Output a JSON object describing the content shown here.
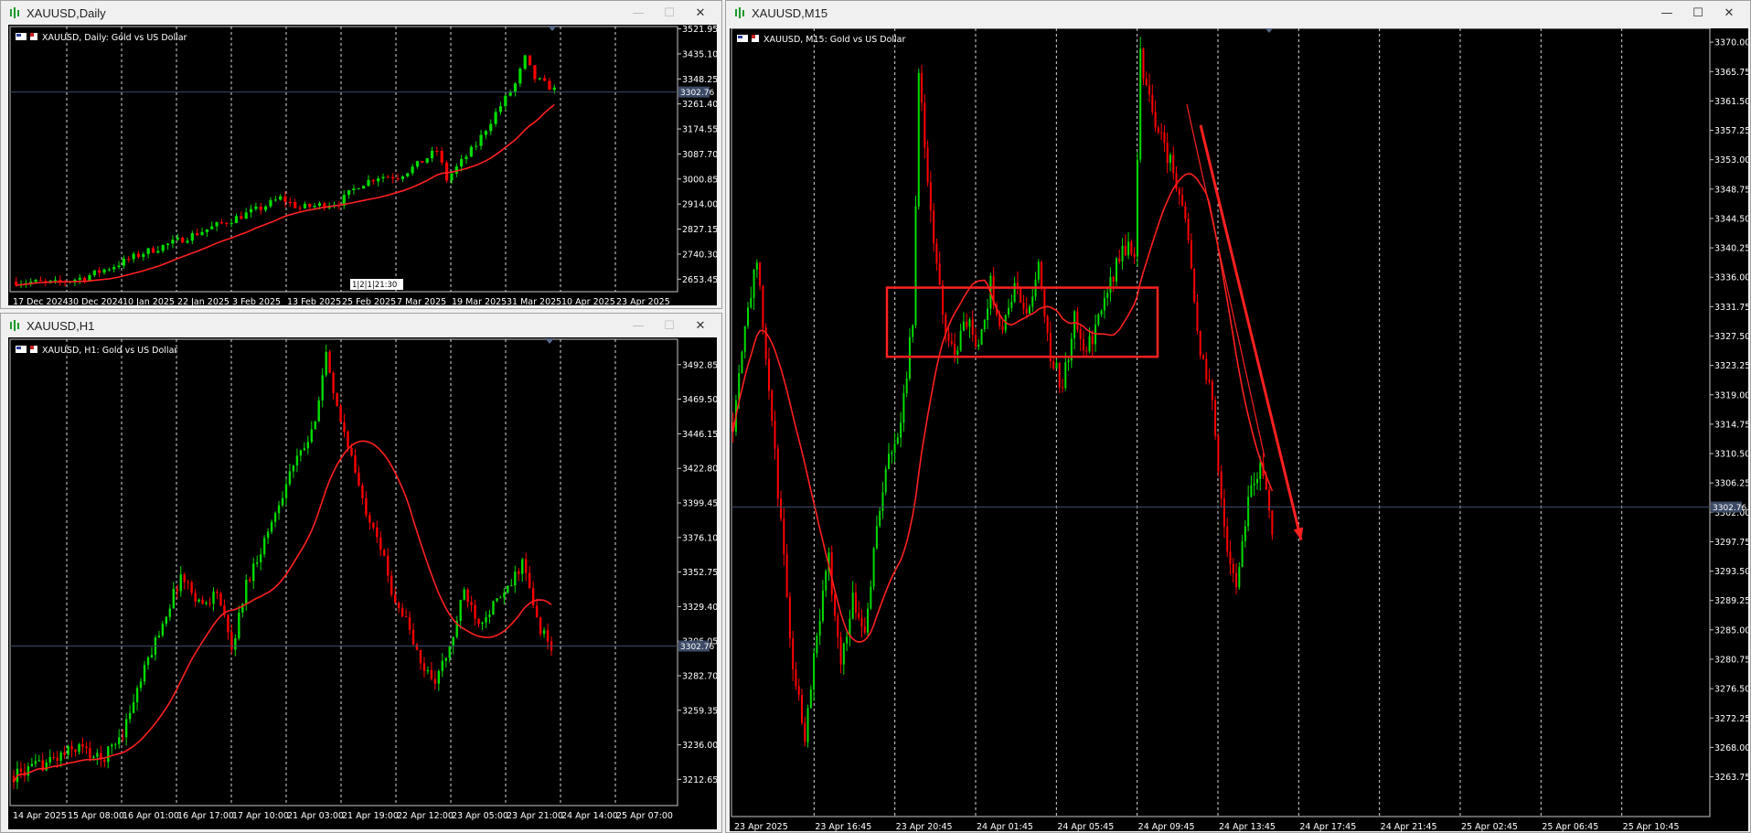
{
  "windows": {
    "daily": {
      "title": "XAUUSD,Daily",
      "chart_label": "XAUUSD, Daily:  Gold vs US Dollar",
      "price_line_label": "3302.76",
      "period_marker": "1|2|1|21:30",
      "buttons": {
        "minimize": "—",
        "maximize": "☐",
        "close": "✕"
      }
    },
    "h1": {
      "title": "XAUUSD,H1",
      "chart_label": "XAUUSD, H1:  Gold vs US Dollar",
      "price_line_label": "3302.76",
      "buttons": {
        "minimize": "—",
        "maximize": "☐",
        "close": "✕"
      }
    },
    "m15": {
      "title": "XAUUSD,M15",
      "chart_label": "XAUUSD, M15:  Gold vs US Dollar",
      "price_line_label": "3302.76",
      "buttons": {
        "minimize": "—",
        "maximize": "☐",
        "close": "✕"
      }
    }
  },
  "colors": {
    "bull": "#00dd00",
    "bear": "#ff0000",
    "ma": "#ff2020",
    "background": "#000000",
    "grid": "#ffffff",
    "price_line": "#3c4a66",
    "annotation": "#ff2020"
  },
  "chart_data": [
    {
      "type": "candlestick",
      "symbol": "XAUUSD",
      "timeframe": "Daily",
      "ylim": [
        2610,
        3530
      ],
      "y_ticks": [
        "3521.95",
        "3435.10",
        "3348.25",
        "3261.40",
        "3174.55",
        "3087.70",
        "3000.85",
        "2914.00",
        "2827.15",
        "2740.30",
        "2653.45"
      ],
      "x_ticks": [
        "17 Dec 2024",
        "30 Dec 2024",
        "10 Jan 2025",
        "22 Jan 2025",
        "3 Feb 2025",
        "13 Feb 2025",
        "25 Feb 2025",
        "7 Mar 2025",
        "19 Mar 2025",
        "31 Mar 2025",
        "10 Apr 2025",
        "23 Apr 2025"
      ],
      "current_price": 3302.76,
      "ma_start": 2640,
      "ma_end": 3185,
      "candle_count": 94,
      "anchors": [
        [
          0,
          2645
        ],
        [
          8,
          2640
        ],
        [
          14,
          2660
        ],
        [
          20,
          2700
        ],
        [
          26,
          2745
        ],
        [
          32,
          2780
        ],
        [
          38,
          2820
        ],
        [
          44,
          2860
        ],
        [
          50,
          2900
        ],
        [
          54,
          2935
        ],
        [
          58,
          2900
        ],
        [
          62,
          2910
        ],
        [
          66,
          2920
        ],
        [
          70,
          2980
        ],
        [
          74,
          3010
        ],
        [
          78,
          3010
        ],
        [
          82,
          3050
        ],
        [
          86,
          3100
        ],
        [
          88,
          3000
        ],
        [
          90,
          3040
        ],
        [
          94,
          3120
        ],
        [
          98,
          3230
        ],
        [
          102,
          3330
        ],
        [
          104,
          3420
        ],
        [
          106,
          3350
        ],
        [
          110,
          3310
        ]
      ]
    },
    {
      "type": "candlestick",
      "symbol": "XAUUSD",
      "timeframe": "H1",
      "ylim": [
        3195,
        3510
      ],
      "y_ticks": [
        "3492.85",
        "3469.50",
        "3446.15",
        "3422.80",
        "3399.45",
        "3376.10",
        "3352.75",
        "3329.40",
        "3306.05",
        "3282.70",
        "3259.35",
        "3236.00",
        "3212.65"
      ],
      "x_ticks": [
        "14 Apr 2025",
        "15 Apr 08:00",
        "16 Apr 01:00",
        "16 Apr 17:00",
        "17 Apr 10:00",
        "21 Apr 03:00",
        "21 Apr 19:00",
        "22 Apr 12:00",
        "23 Apr 05:00",
        "23 Apr 21:00",
        "24 Apr 14:00",
        "25 Apr 07:00"
      ],
      "current_price": 3302.76,
      "anchors": [
        [
          0,
          3215
        ],
        [
          10,
          3225
        ],
        [
          18,
          3235
        ],
        [
          24,
          3225
        ],
        [
          30,
          3245
        ],
        [
          38,
          3300
        ],
        [
          46,
          3350
        ],
        [
          52,
          3330
        ],
        [
          56,
          3340
        ],
        [
          60,
          3300
        ],
        [
          64,
          3345
        ],
        [
          70,
          3380
        ],
        [
          76,
          3420
        ],
        [
          82,
          3445
        ],
        [
          86,
          3500
        ],
        [
          88,
          3470
        ],
        [
          92,
          3440
        ],
        [
          96,
          3400
        ],
        [
          100,
          3380
        ],
        [
          104,
          3340
        ],
        [
          108,
          3320
        ],
        [
          112,
          3290
        ],
        [
          116,
          3280
        ],
        [
          120,
          3300
        ],
        [
          124,
          3340
        ],
        [
          128,
          3320
        ],
        [
          132,
          3330
        ],
        [
          136,
          3340
        ],
        [
          140,
          3360
        ],
        [
          144,
          3320
        ],
        [
          148,
          3300
        ]
      ]
    },
    {
      "type": "candlestick",
      "symbol": "XAUUSD",
      "timeframe": "M15",
      "ylim": [
        3258,
        3372
      ],
      "y_ticks": [
        "3370.00",
        "3365.75",
        "3361.50",
        "3357.25",
        "3353.00",
        "3348.75",
        "3344.50",
        "3340.25",
        "3336.00",
        "3331.75",
        "3327.50",
        "3323.25",
        "3319.00",
        "3314.75",
        "3310.50",
        "3306.25",
        "3302.00",
        "3297.75",
        "3293.50",
        "3289.25",
        "3285.00",
        "3280.75",
        "3276.50",
        "3272.25",
        "3268.00",
        "3263.75"
      ],
      "x_ticks": [
        "23 Apr 2025",
        "23 Apr 16:45",
        "23 Apr 20:45",
        "24 Apr 01:45",
        "24 Apr 05:45",
        "24 Apr 09:45",
        "24 Apr 13:45",
        "24 Apr 17:45",
        "24 Apr 21:45",
        "25 Apr 02:45",
        "25 Apr 06:45",
        "25 Apr 10:45"
      ],
      "current_price": 3302.76,
      "anchors": [
        [
          0,
          3315
        ],
        [
          4,
          3330
        ],
        [
          8,
          3338
        ],
        [
          12,
          3320
        ],
        [
          16,
          3300
        ],
        [
          20,
          3280
        ],
        [
          24,
          3270
        ],
        [
          28,
          3285
        ],
        [
          32,
          3295
        ],
        [
          36,
          3280
        ],
        [
          40,
          3290
        ],
        [
          44,
          3285
        ],
        [
          48,
          3300
        ],
        [
          52,
          3310
        ],
        [
          56,
          3315
        ],
        [
          60,
          3330
        ],
        [
          62,
          3365
        ],
        [
          66,
          3345
        ],
        [
          70,
          3330
        ],
        [
          74,
          3325
        ],
        [
          78,
          3330
        ],
        [
          82,
          3325
        ],
        [
          86,
          3335
        ],
        [
          90,
          3328
        ],
        [
          94,
          3335
        ],
        [
          98,
          3330
        ],
        [
          102,
          3338
        ],
        [
          106,
          3325
        ],
        [
          110,
          3320
        ],
        [
          114,
          3330
        ],
        [
          118,
          3325
        ],
        [
          122,
          3330
        ],
        [
          126,
          3335
        ],
        [
          130,
          3340
        ],
        [
          134,
          3340
        ],
        [
          136,
          3368
        ],
        [
          140,
          3360
        ],
        [
          144,
          3355
        ],
        [
          148,
          3350
        ],
        [
          152,
          3342
        ],
        [
          156,
          3325
        ],
        [
          160,
          3318
        ],
        [
          164,
          3300
        ],
        [
          168,
          3290
        ],
        [
          172,
          3305
        ],
        [
          176,
          3308
        ],
        [
          180,
          3300
        ]
      ],
      "annotations": {
        "rectangle": {
          "price_top": 3334.5,
          "price_bottom": 3324.5
        },
        "arrow": {
          "from_price": 3358,
          "to_price": 3298
        }
      }
    }
  ]
}
